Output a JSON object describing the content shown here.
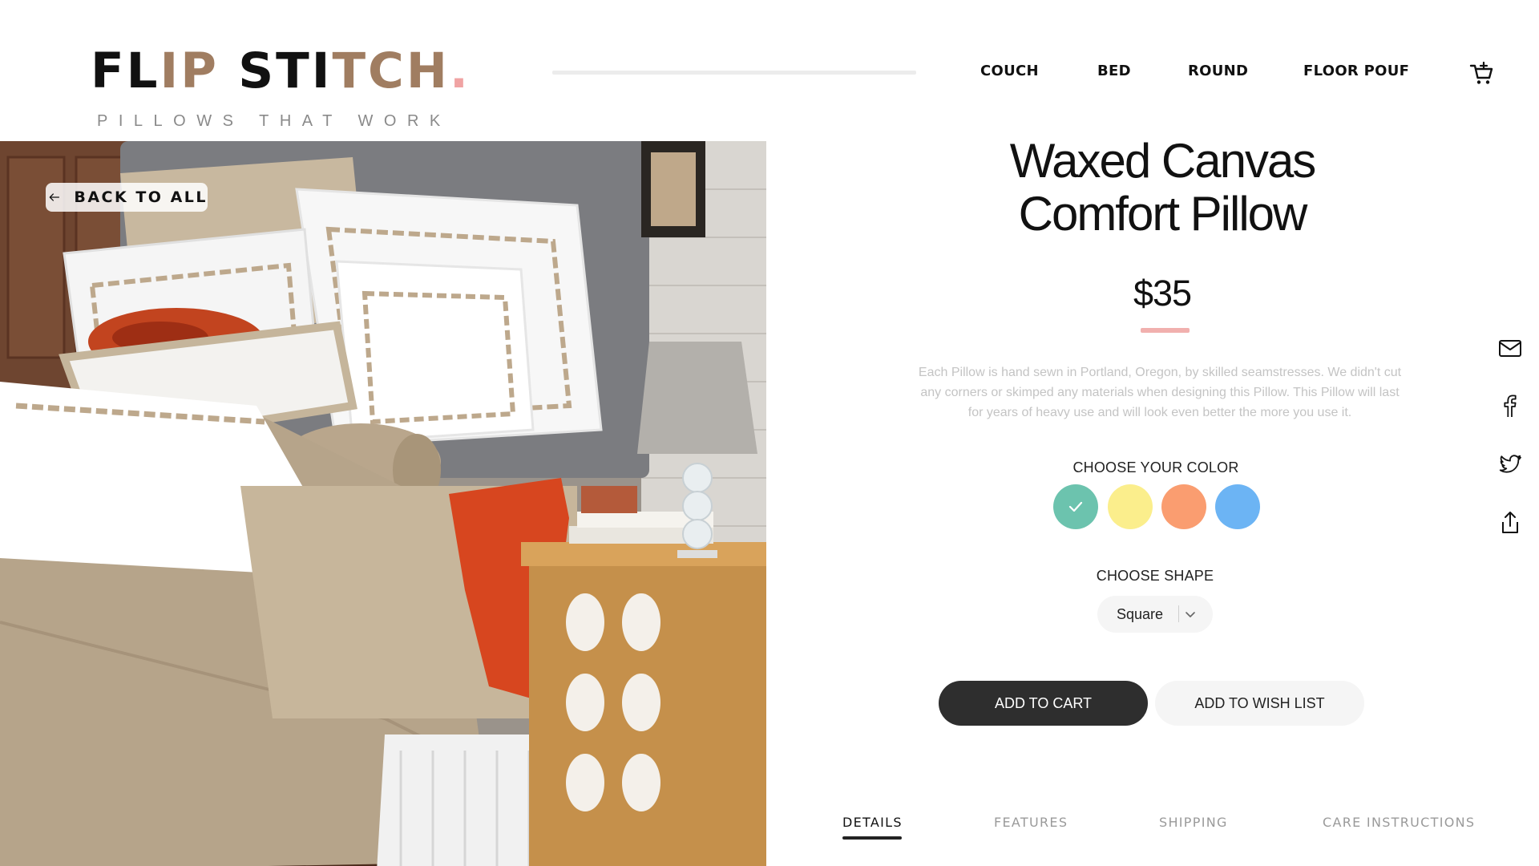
{
  "brand": {
    "part1": "FL",
    "part2": "IP",
    "part3": " STI",
    "part4": "TCH",
    "part5": ".",
    "tagline": "PILLOWS THAT WORK",
    "colors": {
      "dark": "#111111",
      "brown": "#a07d61",
      "dot": "#f0a3a3"
    }
  },
  "nav": {
    "items": [
      {
        "label": "COUCH"
      },
      {
        "label": "BED"
      },
      {
        "label": "ROUND"
      },
      {
        "label": "FLOOR POUF"
      }
    ],
    "cart_icon": "cart-plus-icon"
  },
  "hero": {
    "back_label": "BACK TO ALL",
    "back_icon": "arrow-left-icon"
  },
  "product": {
    "title_line1": "Waxed Canvas",
    "title_line2": "Comfort Pillow",
    "price": "$35",
    "description": "Each Pillow is hand sewn in Portland, Oregon, by skilled seamstresses. We didn't cut any corners or skimped any materials when designing this Pillow. This Pillow will last for years of heavy use and will look even better the more you use it.",
    "color_label": "CHOOSE YOUR COLOR",
    "colors": [
      {
        "name": "teal",
        "hex": "#6cc3ae",
        "selected": true
      },
      {
        "name": "yellow",
        "hex": "#fbee8c",
        "selected": false
      },
      {
        "name": "orange",
        "hex": "#fa9d70",
        "selected": false
      },
      {
        "name": "blue",
        "hex": "#6cb4f4",
        "selected": false
      }
    ],
    "shape_label": "CHOOSE SHAPE",
    "shape_value": "Square",
    "add_to_cart": "ADD TO CART",
    "add_to_wishlist": "ADD TO WISH LIST"
  },
  "tabs": [
    {
      "label": "DETAILS",
      "active": true
    },
    {
      "label": "FEATURES",
      "active": false
    },
    {
      "label": "SHIPPING",
      "active": false
    },
    {
      "label": "CARE INSTRUCTIONS",
      "active": false
    }
  ],
  "share": {
    "icons": [
      "mail-icon",
      "facebook-icon",
      "twitter-icon",
      "share-icon"
    ]
  }
}
